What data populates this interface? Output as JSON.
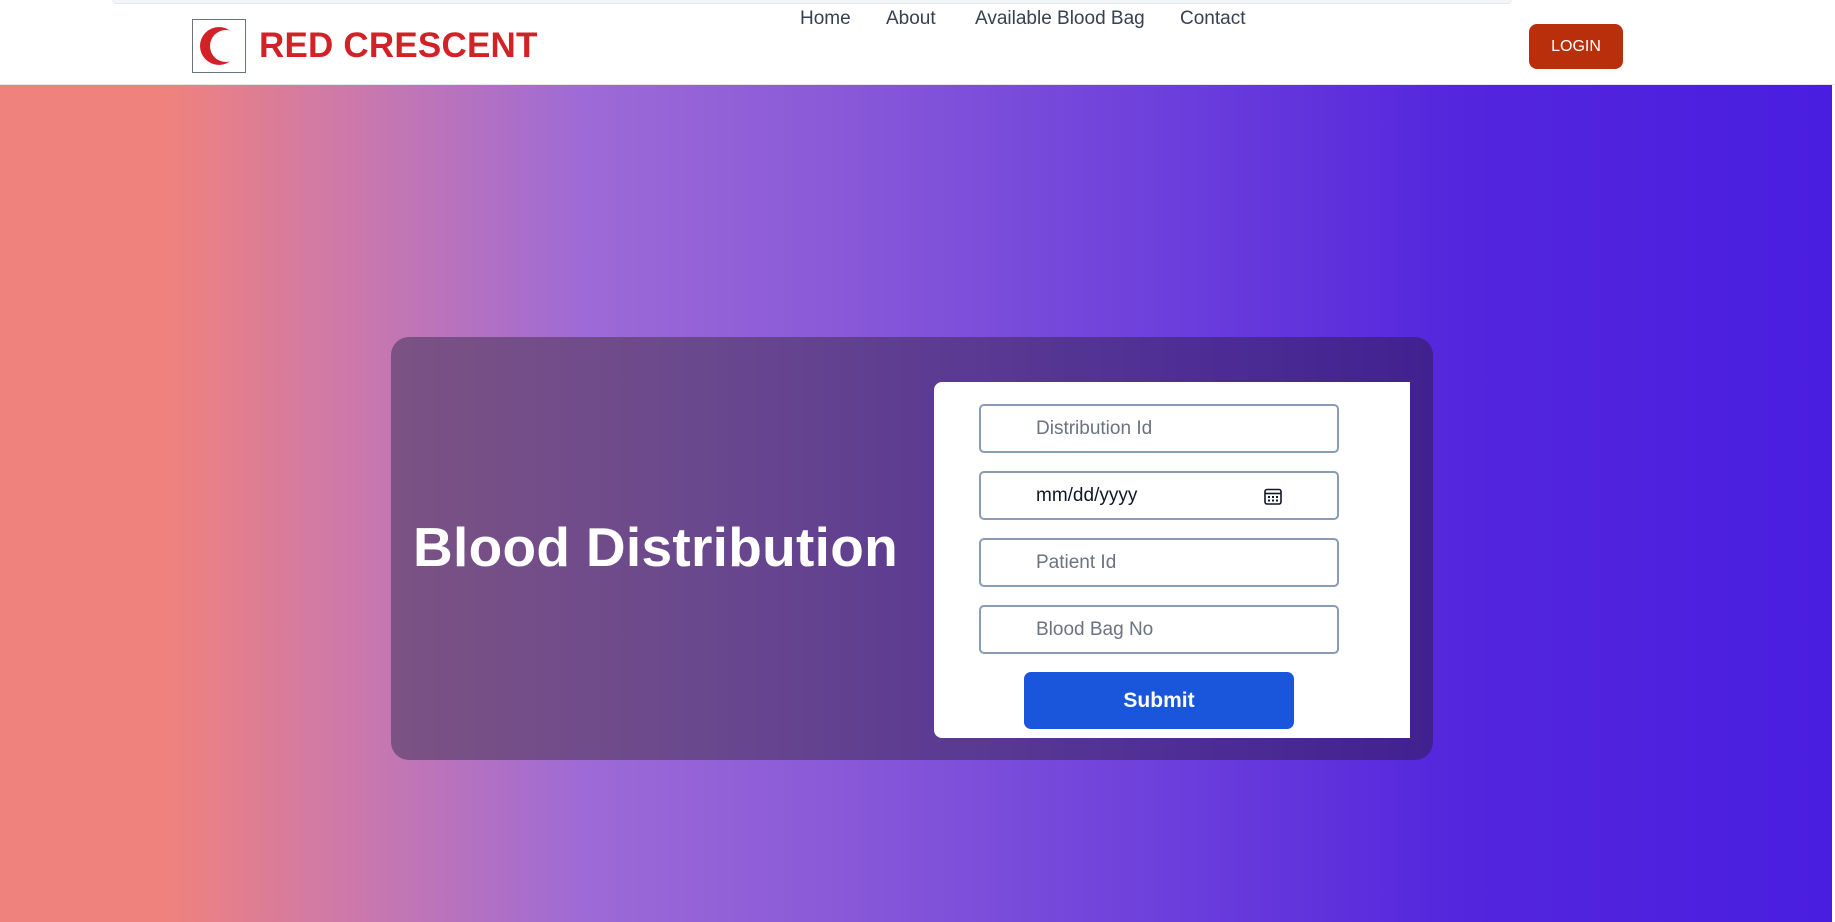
{
  "brand": {
    "name": "RED CRESCENT",
    "logo_icon": "crescent-icon",
    "color": "#d32128"
  },
  "nav": {
    "items": [
      {
        "label": "Home"
      },
      {
        "label": "About"
      },
      {
        "label": "Available Blood Bag"
      },
      {
        "label": "Contact"
      }
    ],
    "login_label": "LOGIN",
    "login_color": "#b92e0b"
  },
  "hero": {
    "title": "Blood Distribution"
  },
  "form": {
    "distribution_id_placeholder": "Distribution Id",
    "date_placeholder": "mm/dd/yyyy",
    "date_icon": "calendar-icon",
    "patient_id_placeholder": "Patient Id",
    "blood_bag_no_placeholder": "Blood Bag No",
    "submit_label": "Submit",
    "submit_color": "#1a56db"
  }
}
